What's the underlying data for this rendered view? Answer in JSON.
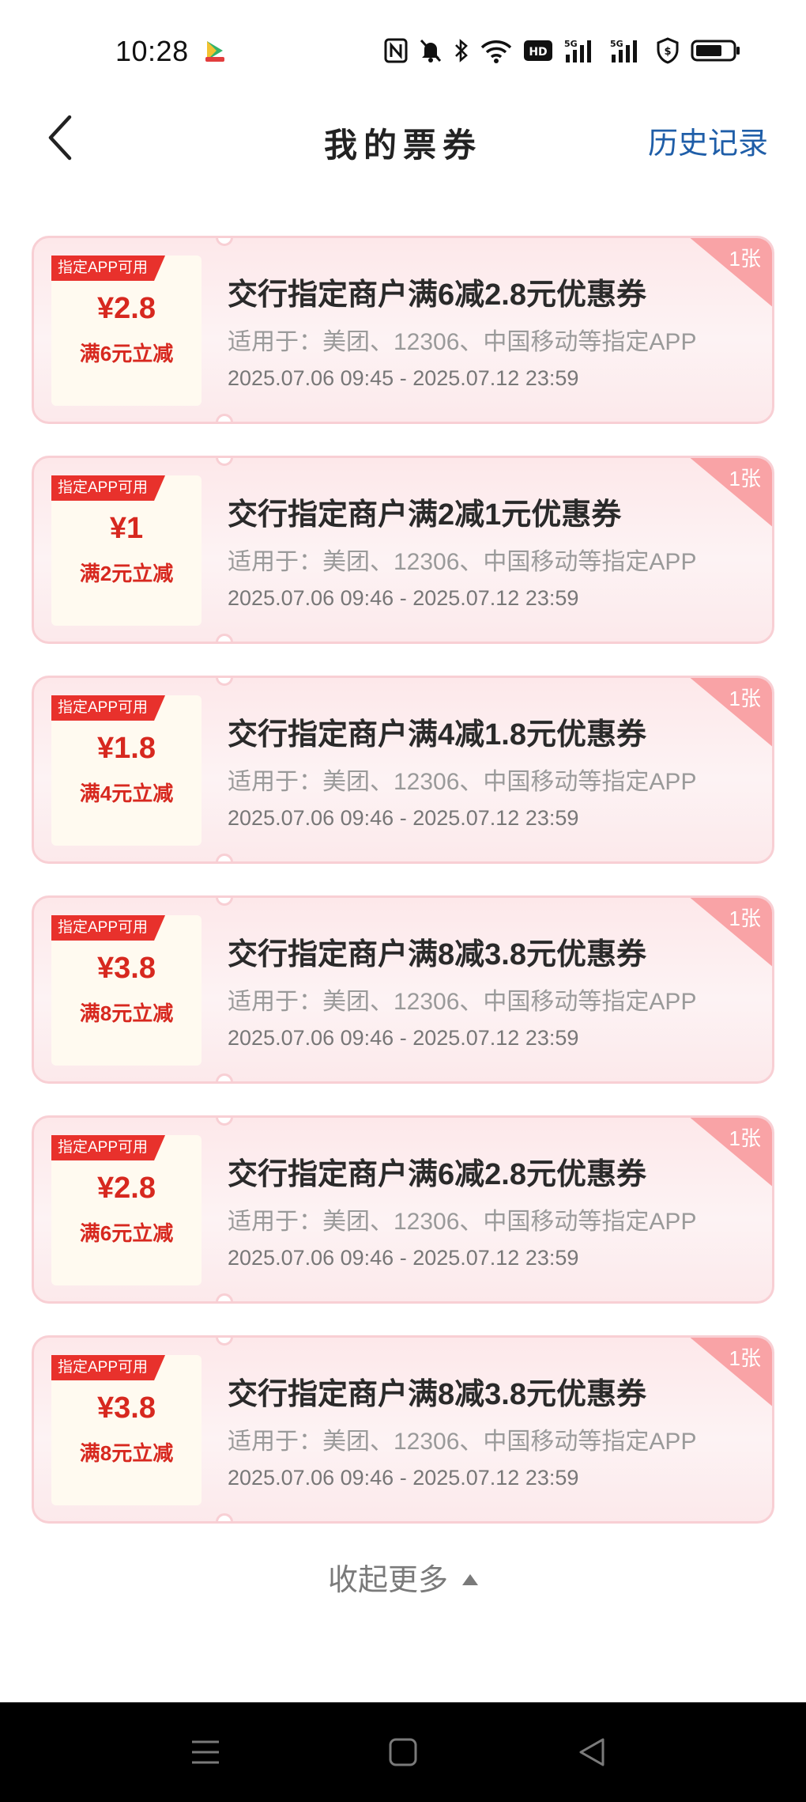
{
  "status_bar": {
    "time": "10:28",
    "icons": [
      "app-video-icon",
      "nfc-icon",
      "mute-icon",
      "bluetooth-icon",
      "wifi-icon",
      "hd-icon",
      "signal-5g-icon",
      "signal-5g-icon",
      "security-icon",
      "battery-icon"
    ],
    "hd_label": "HD",
    "net_label": "5G"
  },
  "nav": {
    "title": "我的票券",
    "history_label": "历史记录"
  },
  "coupons": [
    {
      "badge": "指定APP可用",
      "amount": "¥2.8",
      "condition": "满6元立减",
      "title": "交行指定商户满6减2.8元优惠券",
      "scope": "适用于：美团、12306、中国移动等指定APP",
      "validity": "2025.07.06 09:45 - 2025.07.12 23:59",
      "count": "1张"
    },
    {
      "badge": "指定APP可用",
      "amount": "¥1",
      "condition": "满2元立减",
      "title": "交行指定商户满2减1元优惠券",
      "scope": "适用于：美团、12306、中国移动等指定APP",
      "validity": "2025.07.06 09:46 - 2025.07.12 23:59",
      "count": "1张"
    },
    {
      "badge": "指定APP可用",
      "amount": "¥1.8",
      "condition": "满4元立减",
      "title": "交行指定商户满4减1.8元优惠券",
      "scope": "适用于：美团、12306、中国移动等指定APP",
      "validity": "2025.07.06 09:46 - 2025.07.12 23:59",
      "count": "1张"
    },
    {
      "badge": "指定APP可用",
      "amount": "¥3.8",
      "condition": "满8元立减",
      "title": "交行指定商户满8减3.8元优惠券",
      "scope": "适用于：美团、12306、中国移动等指定APP",
      "validity": "2025.07.06 09:46 - 2025.07.12 23:59",
      "count": "1张"
    },
    {
      "badge": "指定APP可用",
      "amount": "¥2.8",
      "condition": "满6元立减",
      "title": "交行指定商户满6减2.8元优惠券",
      "scope": "适用于：美团、12306、中国移动等指定APP",
      "validity": "2025.07.06 09:46 - 2025.07.12 23:59",
      "count": "1张"
    },
    {
      "badge": "指定APP可用",
      "amount": "¥3.8",
      "condition": "满8元立减",
      "title": "交行指定商户满8减3.8元优惠券",
      "scope": "适用于：美团、12306、中国移动等指定APP",
      "validity": "2025.07.06 09:46 - 2025.07.12 23:59",
      "count": "1张"
    }
  ],
  "collapse_label": "收起更多",
  "colors": {
    "accent_red": "#e8312c",
    "amount_red": "#d7281f",
    "link_blue": "#1f5ea8",
    "corner_pink": "#f9a3a6",
    "card_border": "#f8cfd4"
  }
}
